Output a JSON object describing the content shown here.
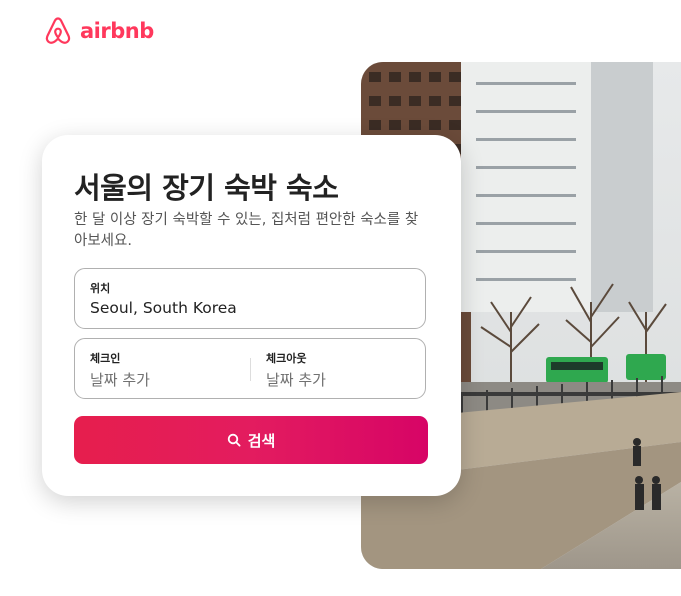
{
  "brand": {
    "name": "airbnb",
    "color": "#ff385c",
    "icon": "airbnb-belo-icon"
  },
  "hero": {
    "title": "서울의 장기 숙박 숙소",
    "subtitle": "한 달 이상 장기 숙박할 수 있는, 집처럼 편안한 숙소를 찾아보세요."
  },
  "search": {
    "location": {
      "label": "위치",
      "value": "Seoul, South Korea"
    },
    "checkin": {
      "label": "체크인",
      "placeholder": "날짜 추가"
    },
    "checkout": {
      "label": "체크아웃",
      "placeholder": "날짜 추가"
    },
    "button_label": "검색",
    "button_icon": "search-icon",
    "button_colors": [
      "#e61e4d",
      "#d70466"
    ]
  },
  "photo": {
    "subject": "Seoul street photo"
  }
}
